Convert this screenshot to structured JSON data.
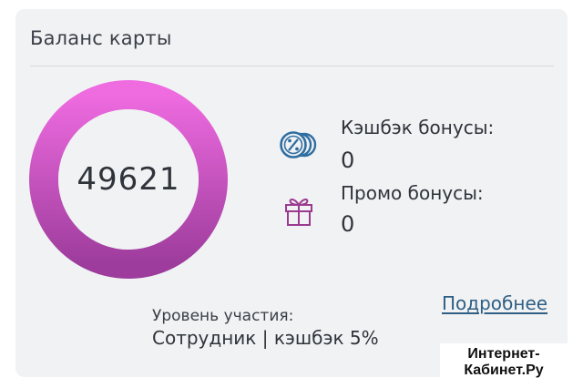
{
  "card": {
    "title": "Баланс карты"
  },
  "balance": {
    "value": "49621",
    "ring_gradient": [
      "#ee6be0",
      "#9d3c9c"
    ]
  },
  "cashback": {
    "icon": "percent-coins-icon",
    "label": "Кэшбэк бонусы:",
    "value": "0",
    "icon_color": "#2f6ea1"
  },
  "promo": {
    "icon": "gift-icon",
    "label": "Промо бонусы:",
    "value": "0",
    "icon_color": "#9b3b8f"
  },
  "level": {
    "label": "Уровень участия:",
    "value": "Сотрудник | кэшбэк 5%"
  },
  "details_link": "Подробнее",
  "watermark": {
    "line1": "Интернет-",
    "line2": "Кабинет.Ру"
  }
}
